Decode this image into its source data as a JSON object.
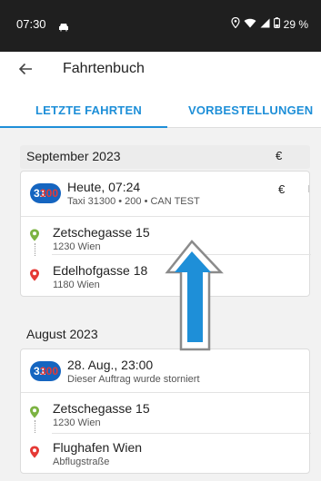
{
  "status_bar": {
    "time": "07:30",
    "battery": "29 %"
  },
  "app_bar": {
    "title": "Fahrtenbuch"
  },
  "tabs": [
    {
      "label": "LETZTE FAHRTEN"
    },
    {
      "label": "VORBESTELLUNGEN"
    }
  ],
  "sections": [
    {
      "month": "September 2023",
      "currency": "€",
      "trips": [
        {
          "logo_text_white": "31",
          "logo_text_red": "300",
          "date": "Heute, 07:24",
          "subtitle": "Taxi 31300 • 200 • CAN TEST",
          "price": "€",
          "from": {
            "street": "Zetschegasse 15",
            "city": "1230 Wien"
          },
          "to": {
            "street": "Edelhofgasse 18",
            "city": "1180 Wien"
          }
        }
      ]
    },
    {
      "month": "August 2023",
      "trips": [
        {
          "logo_text_white": "31",
          "logo_text_red": "300",
          "date": "28. Aug., 23:00",
          "subtitle": "Dieser Auftrag wurde storniert",
          "from": {
            "street": "Zetschegasse 15",
            "city": "1230 Wien"
          },
          "to": {
            "street": "Flughafen Wien",
            "city": "Abflugstraße"
          }
        }
      ]
    }
  ],
  "colors": {
    "accent": "#1e8fd8",
    "status_bar": "#1f1f1f",
    "pickup_pin": "#7cb342",
    "dropoff_pin": "#e53935",
    "logo_blue": "#1565c0"
  },
  "icons": [
    "back-arrow-icon",
    "car-icon",
    "location-icon",
    "wifi-icon",
    "signal-icon",
    "battery-icon",
    "pickup-pin-icon",
    "dropoff-pin-icon",
    "scroll-up-arrow-icon"
  ]
}
